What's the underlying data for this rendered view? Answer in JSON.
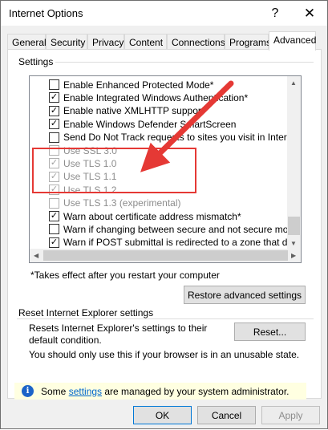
{
  "window": {
    "title": "Internet Options",
    "help_glyph": "?",
    "close_glyph": "✕"
  },
  "tabs": [
    {
      "label": "General"
    },
    {
      "label": "Security"
    },
    {
      "label": "Privacy"
    },
    {
      "label": "Content"
    },
    {
      "label": "Connections"
    },
    {
      "label": "Programs"
    },
    {
      "label": "Advanced",
      "active": true
    }
  ],
  "settings_group": {
    "label": "Settings",
    "items": [
      {
        "label": "Enable Enhanced Protected Mode*",
        "checked": false,
        "enabled": true
      },
      {
        "label": "Enable Integrated Windows Authentication*",
        "checked": true,
        "enabled": true
      },
      {
        "label": "Enable native XMLHTTP support",
        "checked": true,
        "enabled": true
      },
      {
        "label": "Enable Windows Defender SmartScreen",
        "checked": true,
        "enabled": true
      },
      {
        "label": "Send Do Not Track requests to sites you visit in Internet E",
        "checked": false,
        "enabled": true
      },
      {
        "label": "Use SSL 3.0",
        "checked": false,
        "enabled": false
      },
      {
        "label": "Use TLS 1.0",
        "checked": true,
        "enabled": false
      },
      {
        "label": "Use TLS 1.1",
        "checked": true,
        "enabled": false
      },
      {
        "label": "Use TLS 1.2",
        "checked": true,
        "enabled": false
      },
      {
        "label": "Use TLS 1.3 (experimental)",
        "checked": false,
        "enabled": false
      },
      {
        "label": "Warn about certificate address mismatch*",
        "checked": true,
        "enabled": true
      },
      {
        "label": "Warn if changing between secure and not secure mode",
        "checked": false,
        "enabled": true
      },
      {
        "label": "Warn if POST submittal is redirected to a zone that does n",
        "checked": true,
        "enabled": true
      }
    ],
    "note": "*Takes effect after you restart your computer",
    "restore_label": "Restore advanced settings"
  },
  "reset_group": {
    "label": "Reset Internet Explorer settings",
    "description": "Resets Internet Explorer's settings to their default condition.",
    "reset_label": "Reset...",
    "warning": "You should only use this if your browser is in an unusable state."
  },
  "infobar": {
    "prefix": "Some ",
    "link": "settings",
    "suffix": " are managed by your system administrator.",
    "icon": "i"
  },
  "footer": {
    "ok": "OK",
    "cancel": "Cancel",
    "apply": "Apply"
  },
  "colors": {
    "annotation": "#e53935",
    "accent": "#0078d7"
  }
}
